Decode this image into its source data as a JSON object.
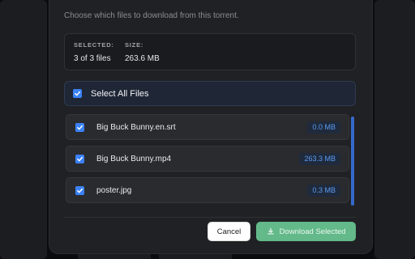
{
  "dialog": {
    "subtitle": "Choose which files to download from this torrent.",
    "summary": {
      "selected_label": "SELECTED:",
      "selected_value": "3 of 3 files",
      "size_label": "SIZE:",
      "size_value": "263.6 MB"
    },
    "select_all": {
      "label": "Select All Files",
      "checked": true
    },
    "files": [
      {
        "name": "Big Buck Bunny.en.srt",
        "size": "0.0 MB",
        "checked": true
      },
      {
        "name": "Big Buck Bunny.mp4",
        "size": "263.3 MB",
        "checked": true
      },
      {
        "name": "poster.jpg",
        "size": "0.3 MB",
        "checked": true
      }
    ],
    "buttons": {
      "cancel": "Cancel",
      "download": "Download Selected"
    }
  },
  "colors": {
    "accent": "#3b82f6",
    "download_button": "#63b98a",
    "size_badge_text": "#5b9bf0"
  },
  "icons": {
    "checkbox": "check-icon",
    "download": "download-icon"
  }
}
